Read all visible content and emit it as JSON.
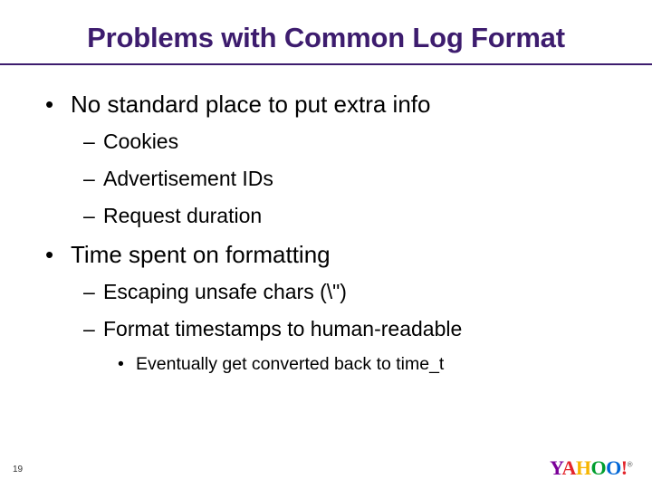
{
  "title": "Problems with Common Log Format",
  "bullets": [
    {
      "text": "No standard place to put extra info",
      "children": [
        {
          "text": "Cookies"
        },
        {
          "text": "Advertisement IDs"
        },
        {
          "text": "Request duration"
        }
      ]
    },
    {
      "text": "Time spent on formatting",
      "children": [
        {
          "text": "Escaping unsafe chars (\\\")"
        },
        {
          "text": "Format timestamps to human-readable",
          "children": [
            {
              "text": "Eventually get converted back to time_t"
            }
          ]
        }
      ]
    }
  ],
  "pageNumber": "19",
  "logo": {
    "text": "YAHOO!",
    "tm": "®"
  }
}
